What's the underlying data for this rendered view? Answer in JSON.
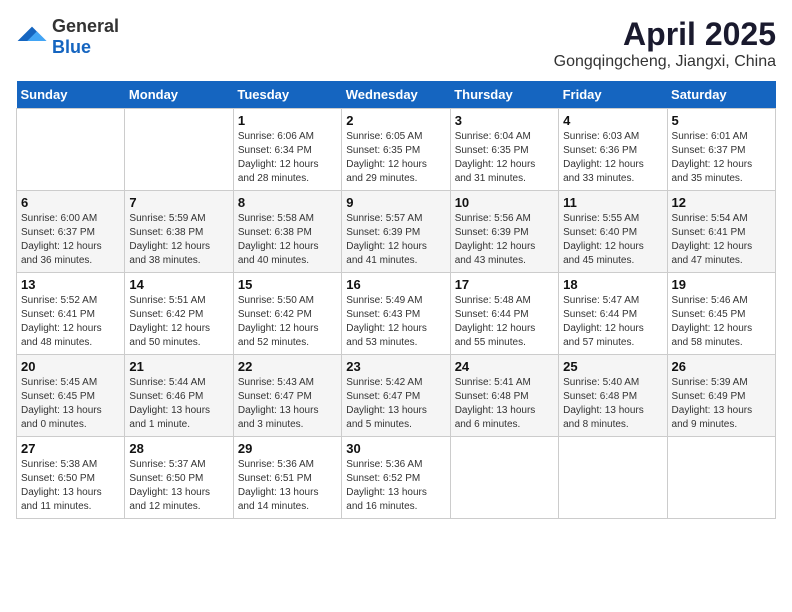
{
  "header": {
    "logo_general": "General",
    "logo_blue": "Blue",
    "month_title": "April 2025",
    "location": "Gongqingcheng, Jiangxi, China"
  },
  "columns": [
    "Sunday",
    "Monday",
    "Tuesday",
    "Wednesday",
    "Thursday",
    "Friday",
    "Saturday"
  ],
  "weeks": [
    [
      {
        "day": "",
        "sunrise": "",
        "sunset": "",
        "daylight": ""
      },
      {
        "day": "",
        "sunrise": "",
        "sunset": "",
        "daylight": ""
      },
      {
        "day": "1",
        "sunrise": "Sunrise: 6:06 AM",
        "sunset": "Sunset: 6:34 PM",
        "daylight": "Daylight: 12 hours and 28 minutes."
      },
      {
        "day": "2",
        "sunrise": "Sunrise: 6:05 AM",
        "sunset": "Sunset: 6:35 PM",
        "daylight": "Daylight: 12 hours and 29 minutes."
      },
      {
        "day": "3",
        "sunrise": "Sunrise: 6:04 AM",
        "sunset": "Sunset: 6:35 PM",
        "daylight": "Daylight: 12 hours and 31 minutes."
      },
      {
        "day": "4",
        "sunrise": "Sunrise: 6:03 AM",
        "sunset": "Sunset: 6:36 PM",
        "daylight": "Daylight: 12 hours and 33 minutes."
      },
      {
        "day": "5",
        "sunrise": "Sunrise: 6:01 AM",
        "sunset": "Sunset: 6:37 PM",
        "daylight": "Daylight: 12 hours and 35 minutes."
      }
    ],
    [
      {
        "day": "6",
        "sunrise": "Sunrise: 6:00 AM",
        "sunset": "Sunset: 6:37 PM",
        "daylight": "Daylight: 12 hours and 36 minutes."
      },
      {
        "day": "7",
        "sunrise": "Sunrise: 5:59 AM",
        "sunset": "Sunset: 6:38 PM",
        "daylight": "Daylight: 12 hours and 38 minutes."
      },
      {
        "day": "8",
        "sunrise": "Sunrise: 5:58 AM",
        "sunset": "Sunset: 6:38 PM",
        "daylight": "Daylight: 12 hours and 40 minutes."
      },
      {
        "day": "9",
        "sunrise": "Sunrise: 5:57 AM",
        "sunset": "Sunset: 6:39 PM",
        "daylight": "Daylight: 12 hours and 41 minutes."
      },
      {
        "day": "10",
        "sunrise": "Sunrise: 5:56 AM",
        "sunset": "Sunset: 6:39 PM",
        "daylight": "Daylight: 12 hours and 43 minutes."
      },
      {
        "day": "11",
        "sunrise": "Sunrise: 5:55 AM",
        "sunset": "Sunset: 6:40 PM",
        "daylight": "Daylight: 12 hours and 45 minutes."
      },
      {
        "day": "12",
        "sunrise": "Sunrise: 5:54 AM",
        "sunset": "Sunset: 6:41 PM",
        "daylight": "Daylight: 12 hours and 47 minutes."
      }
    ],
    [
      {
        "day": "13",
        "sunrise": "Sunrise: 5:52 AM",
        "sunset": "Sunset: 6:41 PM",
        "daylight": "Daylight: 12 hours and 48 minutes."
      },
      {
        "day": "14",
        "sunrise": "Sunrise: 5:51 AM",
        "sunset": "Sunset: 6:42 PM",
        "daylight": "Daylight: 12 hours and 50 minutes."
      },
      {
        "day": "15",
        "sunrise": "Sunrise: 5:50 AM",
        "sunset": "Sunset: 6:42 PM",
        "daylight": "Daylight: 12 hours and 52 minutes."
      },
      {
        "day": "16",
        "sunrise": "Sunrise: 5:49 AM",
        "sunset": "Sunset: 6:43 PM",
        "daylight": "Daylight: 12 hours and 53 minutes."
      },
      {
        "day": "17",
        "sunrise": "Sunrise: 5:48 AM",
        "sunset": "Sunset: 6:44 PM",
        "daylight": "Daylight: 12 hours and 55 minutes."
      },
      {
        "day": "18",
        "sunrise": "Sunrise: 5:47 AM",
        "sunset": "Sunset: 6:44 PM",
        "daylight": "Daylight: 12 hours and 57 minutes."
      },
      {
        "day": "19",
        "sunrise": "Sunrise: 5:46 AM",
        "sunset": "Sunset: 6:45 PM",
        "daylight": "Daylight: 12 hours and 58 minutes."
      }
    ],
    [
      {
        "day": "20",
        "sunrise": "Sunrise: 5:45 AM",
        "sunset": "Sunset: 6:45 PM",
        "daylight": "Daylight: 13 hours and 0 minutes."
      },
      {
        "day": "21",
        "sunrise": "Sunrise: 5:44 AM",
        "sunset": "Sunset: 6:46 PM",
        "daylight": "Daylight: 13 hours and 1 minute."
      },
      {
        "day": "22",
        "sunrise": "Sunrise: 5:43 AM",
        "sunset": "Sunset: 6:47 PM",
        "daylight": "Daylight: 13 hours and 3 minutes."
      },
      {
        "day": "23",
        "sunrise": "Sunrise: 5:42 AM",
        "sunset": "Sunset: 6:47 PM",
        "daylight": "Daylight: 13 hours and 5 minutes."
      },
      {
        "day": "24",
        "sunrise": "Sunrise: 5:41 AM",
        "sunset": "Sunset: 6:48 PM",
        "daylight": "Daylight: 13 hours and 6 minutes."
      },
      {
        "day": "25",
        "sunrise": "Sunrise: 5:40 AM",
        "sunset": "Sunset: 6:48 PM",
        "daylight": "Daylight: 13 hours and 8 minutes."
      },
      {
        "day": "26",
        "sunrise": "Sunrise: 5:39 AM",
        "sunset": "Sunset: 6:49 PM",
        "daylight": "Daylight: 13 hours and 9 minutes."
      }
    ],
    [
      {
        "day": "27",
        "sunrise": "Sunrise: 5:38 AM",
        "sunset": "Sunset: 6:50 PM",
        "daylight": "Daylight: 13 hours and 11 minutes."
      },
      {
        "day": "28",
        "sunrise": "Sunrise: 5:37 AM",
        "sunset": "Sunset: 6:50 PM",
        "daylight": "Daylight: 13 hours and 12 minutes."
      },
      {
        "day": "29",
        "sunrise": "Sunrise: 5:36 AM",
        "sunset": "Sunset: 6:51 PM",
        "daylight": "Daylight: 13 hours and 14 minutes."
      },
      {
        "day": "30",
        "sunrise": "Sunrise: 5:36 AM",
        "sunset": "Sunset: 6:52 PM",
        "daylight": "Daylight: 13 hours and 16 minutes."
      },
      {
        "day": "",
        "sunrise": "",
        "sunset": "",
        "daylight": ""
      },
      {
        "day": "",
        "sunrise": "",
        "sunset": "",
        "daylight": ""
      },
      {
        "day": "",
        "sunrise": "",
        "sunset": "",
        "daylight": ""
      }
    ]
  ]
}
